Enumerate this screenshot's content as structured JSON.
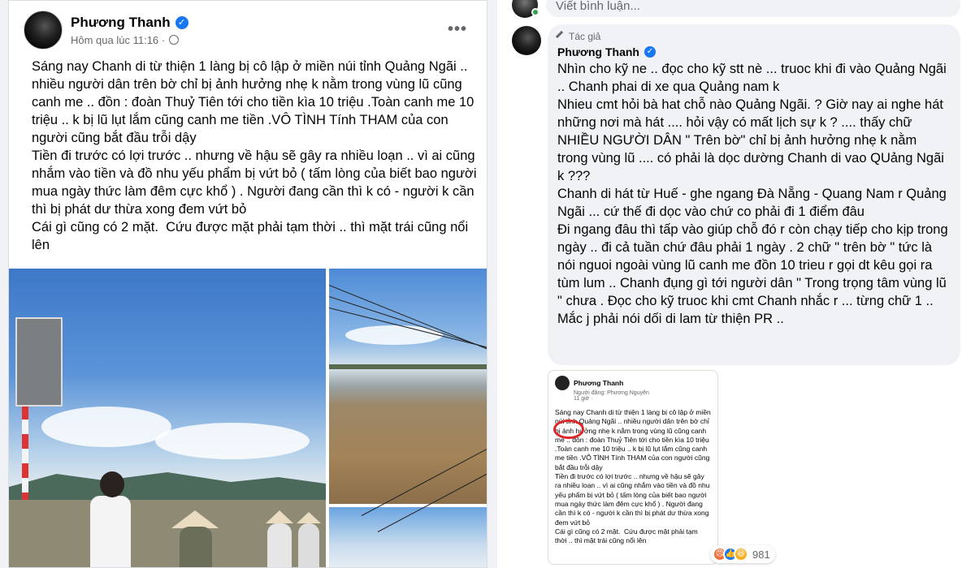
{
  "post": {
    "author": "Phương Thanh",
    "timestamp": "Hôm qua lúc 11:16 ·",
    "more_label": "•••",
    "paragraphs": [
      "Sáng nay Chanh di từ thiện 1 làng bị cô lập ở miền núi tỉnh Quảng Ngãi .. nhiều người dân trên bờ chỉ bị ảnh hưởng nhẹ k nằm trong vùng lũ cũng canh me .. đồn : đoàn Thuỷ Tiên tới cho tiền kìa 10 triệu .Toàn canh me 10 triệu .. k bị lũ lụt lắm cũng canh me tiền .VÔ TÌNH Tính THAM của con người cũng bắt đầu trỗi dậy",
      "Tiền đi trước có lợi trước .. nhưng về hậu sẽ gây ra nhiều loạn .. vì ai cũng nhắm vào tiền và đồ nhu yếu phẩm bị vứt bỏ ( tấm lòng của biết bao người mua ngày thức làm đêm cực khổ ) . Người đang cần thì k có - người k cần thì bị phát dư thừa xong đem vứt bỏ",
      "Cái gì cũng có 2 mặt.  Cứu được mặt phải tạm thời .. thì mặt trái cũng nổi lên"
    ]
  },
  "thread": {
    "write_placeholder": "Viết bình luận...",
    "comment": {
      "author_tag": "Tác giả",
      "author": "Phương Thanh",
      "paragraphs": [
        "Nhìn cho kỹ ne .. đọc cho kỹ stt nè ... truoc khi đi vào Quảng Ngãi .. Chanh phai di xe qua Quảng nam k",
        "Nhieu cmt hỏi bà hat chỗ nào Quảng Ngãi. ? Giờ nay ai nghe hát những nơi mà hát .... hỏi vậy có mất lịch sự k ? .... thấy chữ NHIỀU NGƯỜI DÂN \" Trên bờ\" chỉ bị ảnh hưởng nhẹ k nằm trong vùng lũ .... có phải là dọc dường Chanh di vao QUảng Ngãi k ???",
        "Chanh di hát từ Huế - ghe ngang Đà Nẵng - Quang Nam r Quảng Ngãi ... cứ thế đi dọc vào chứ co phải đi 1 điểm đâu",
        "Đi ngang đâu thì tấp vào giúp chỗ đó r còn chạy tiếp cho kịp trong ngày .. đi cả tuần chứ đâu phải 1 ngày . 2 chữ \" trên bờ \" tức là nói nguoi ngoài vùng lũ canh me đồn 10 trieu r gọi dt kêu gọi ra tùm lum .. Chanh đụng gì tới người dân \" Trong trọng tâm vùng lũ \" chưa . Đọc cho kỹ truoc khi cmt Chanh nhắc r ... từng chữ 1 ..",
        "Mắc j phải nói dối di lam từ thiện PR .."
      ]
    },
    "screenshot": {
      "author": "Phương Thanh",
      "shared_by": "Người đăng: Phương Nguyên",
      "time": "11 giờ · ",
      "paragraphs": [
        "Sáng nay Chanh di từ thiện 1 làng bị cô lập ở miền núi tỉnh Quảng Ngãi .. nhiều người dân trên bờ chỉ bị ảnh hưởng nhẹ k nằm trong vùng lũ cũng canh me .. đồn : đoàn Thuỷ Tiên tới cho tiền kìa 10 triệu .Toàn canh me 10 triệu .. k bị lũ lụt lắm cũng canh me tiền .VÔ TÌNH Tính THAM của con người cũng bắt đầu trỗi dậy",
        "Tiền đi trước có lợi trước .. nhưng về hậu sẽ gây ra nhiều loạn .. vì ai cũng nhắm vào tiền và đồ nhu yếu phẩm bị vứt bỏ ( tấm lòng của biết bao người mua ngày thức làm đêm cực khổ ) . Người đang cần thì k có - người k cần thì bị phát dư thừa xong đem vứt bỏ",
        "Cái gì cũng có 2 mặt.  Cứu được mặt phải tạm thời .. thì mặt trái cũng nổi lên"
      ]
    },
    "reactions": {
      "count": "981",
      "icons": [
        "angry-icon",
        "like-icon",
        "haha-icon"
      ]
    }
  },
  "colors": {
    "accent": "#1877f2",
    "muted": "#65676b",
    "bubble": "#f0f2f5",
    "highlight": "#e0262a"
  }
}
